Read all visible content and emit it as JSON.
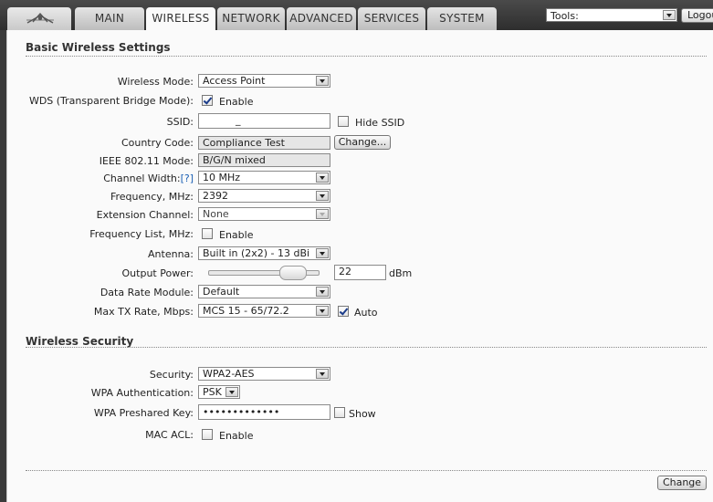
{
  "nav": {
    "tabs": [
      {
        "label": "MAIN"
      },
      {
        "label": "WIRELESS"
      },
      {
        "label": "NETWORK"
      },
      {
        "label": "ADVANCED"
      },
      {
        "label": "SERVICES"
      },
      {
        "label": "SYSTEM"
      }
    ],
    "active_tab": "WIRELESS",
    "tools_value": "Tools:",
    "logout_label": "Logout"
  },
  "basic": {
    "title": "Basic Wireless Settings",
    "wireless_mode": {
      "label": "Wireless Mode:",
      "value": "Access Point"
    },
    "wds": {
      "label": "WDS (Transparent Bridge Mode):",
      "checked": true,
      "option": "Enable"
    },
    "ssid": {
      "label": "SSID:",
      "value": "_",
      "hide_label": "Hide SSID",
      "hide_checked": false
    },
    "country": {
      "label": "Country Code:",
      "value": "Compliance Test",
      "button": "Change..."
    },
    "ieee": {
      "label": "IEEE 802.11 Mode:",
      "value": "B/G/N mixed"
    },
    "channel_width": {
      "label": "Channel Width:",
      "help": "[?]",
      "value": "10 MHz"
    },
    "frequency": {
      "label": "Frequency, MHz:",
      "value": "2392"
    },
    "extension": {
      "label": "Extension Channel:",
      "value": "None"
    },
    "freq_list": {
      "label": "Frequency List, MHz:",
      "checked": false,
      "option": "Enable"
    },
    "antenna": {
      "label": "Antenna:",
      "value": "Built in (2x2) - 13 dBi"
    },
    "output_power": {
      "label": "Output Power:",
      "value": "22",
      "unit": "dBm",
      "level": 0.85
    },
    "data_rate": {
      "label": "Data Rate Module:",
      "value": "Default"
    },
    "max_tx": {
      "label": "Max TX Rate, Mbps:",
      "value": "MCS 15 - 65/72.2",
      "auto_checked": true,
      "auto_label": "Auto"
    }
  },
  "security": {
    "title": "Wireless Security",
    "security": {
      "label": "Security:",
      "value": "WPA2-AES"
    },
    "wpa_auth": {
      "label": "WPA Authentication:",
      "value": "PSK"
    },
    "psk": {
      "label": "WPA Preshared Key:",
      "value": "•••••••••••••",
      "show_label": "Show",
      "show_checked": false
    },
    "mac_acl": {
      "label": "MAC ACL:",
      "checked": false,
      "option": "Enable"
    }
  },
  "footer": {
    "change_label": "Change"
  }
}
